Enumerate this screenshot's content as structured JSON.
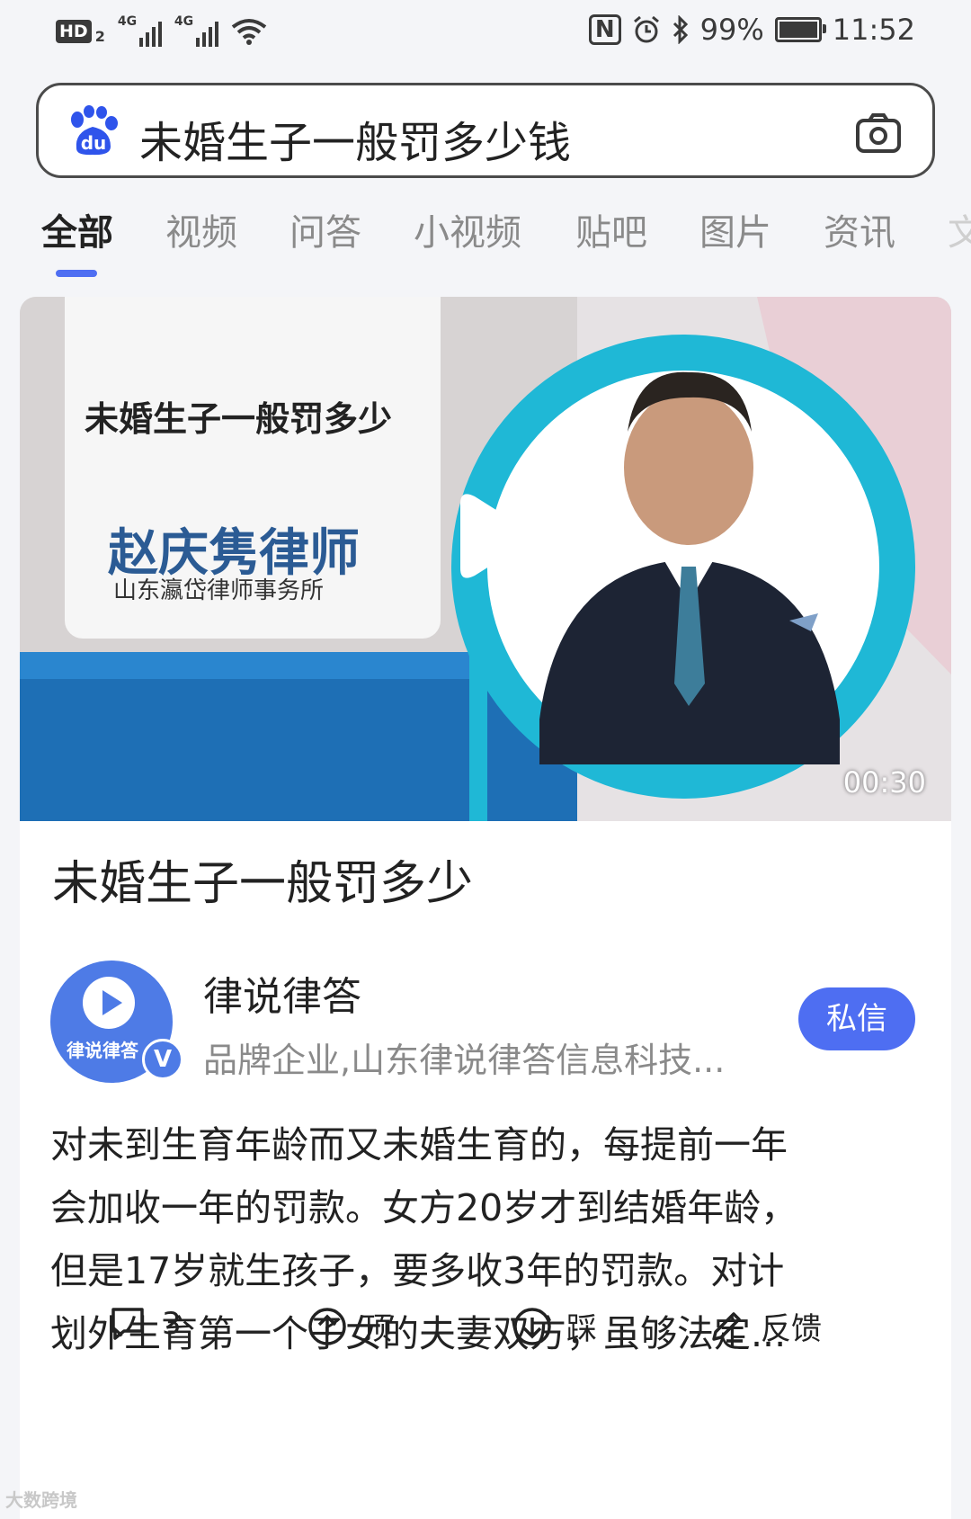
{
  "status_bar": {
    "hd_label": "HD",
    "hd_sub": "2",
    "signal1_label": "4G",
    "signal2_label": "4G",
    "battery_percent": "99%",
    "battery_level": 0.99,
    "time": "11:52",
    "nfc_label": "N"
  },
  "search": {
    "query": "未婚生子一般罚多少钱",
    "logo_text": "du"
  },
  "tabs": [
    {
      "label": "全部",
      "active": true
    },
    {
      "label": "视频"
    },
    {
      "label": "问答"
    },
    {
      "label": "小视频"
    },
    {
      "label": "贴吧"
    },
    {
      "label": "图片"
    },
    {
      "label": "资讯"
    },
    {
      "label": "文"
    }
  ],
  "video": {
    "overlay_title": "未婚生子一般罚多少",
    "lawyer_name": "赵庆隽律师",
    "firm": "山东瀛岱律师事务所",
    "duration": "00:30",
    "colors": {
      "accent": "#1fb8d6",
      "band": "#1e6fb5"
    }
  },
  "post": {
    "title": "未婚生子一般罚多少",
    "author": {
      "name": "律说律答",
      "avatar_text": "律说律答",
      "badge": "V",
      "description": "品牌企业,山东律说律答信息科技..."
    },
    "dm_label": "私信",
    "summary_lines": [
      "对未到生育年龄而又未婚生育的，每提前一年",
      "会加收一年的罚款。女方20岁才到结婚年龄，",
      "但是17岁就生孩子，要多收3年的罚款。对计",
      "划外生育第一个子女的夫妻双方，虽够法定..."
    ]
  },
  "actions": {
    "comment_count": "3",
    "up_label": "顶",
    "down_label": "踩",
    "feedback_label": "反馈"
  },
  "watermark": "大数跨境",
  "colors": {
    "brand_blue": "#4e6ef2"
  }
}
